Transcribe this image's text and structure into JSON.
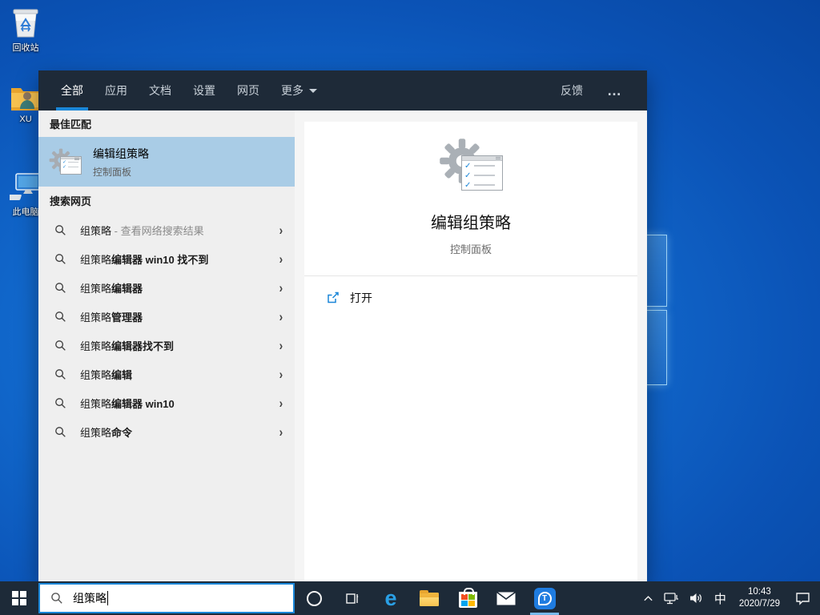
{
  "desktop": {
    "icons": [
      {
        "label": "回收站"
      },
      {
        "label": "XU"
      },
      {
        "label": "此电脑"
      }
    ]
  },
  "panel": {
    "tabs": [
      {
        "label": "全部",
        "active": true
      },
      {
        "label": "应用",
        "active": false
      },
      {
        "label": "文档",
        "active": false
      },
      {
        "label": "设置",
        "active": false
      },
      {
        "label": "网页",
        "active": false
      },
      {
        "label": "更多",
        "active": false
      }
    ],
    "feedback_label": "反馈",
    "overflow_label": "…",
    "best_match_header": "最佳匹配",
    "best_match": {
      "title": "编辑组策略",
      "subtitle": "控制面板"
    },
    "web_header": "搜索网页",
    "suggestions": [
      {
        "prefix": "组策略",
        "suffix": " - 查看网络搜索结果",
        "type": "web"
      },
      {
        "prefix": "组策略",
        "suffix": "编辑器 win10 找不到",
        "type": "query"
      },
      {
        "prefix": "组策略",
        "suffix": "编辑器",
        "type": "query"
      },
      {
        "prefix": "组策略",
        "suffix": "管理器",
        "type": "query"
      },
      {
        "prefix": "组策略",
        "suffix": "编辑器找不到",
        "type": "query"
      },
      {
        "prefix": "组策略",
        "suffix": "编辑",
        "type": "query"
      },
      {
        "prefix": "组策略",
        "suffix": "编辑器 win10",
        "type": "query"
      },
      {
        "prefix": "组策略",
        "suffix": "命令",
        "type": "query"
      }
    ],
    "chevron_glyph": "›",
    "preview": {
      "title": "编辑组策略",
      "subtitle": "控制面板",
      "open_label": "打开"
    }
  },
  "taskbar": {
    "search_value": "组策略",
    "tray": {
      "ime": "中",
      "time": "10:43",
      "date": "2020/7/29"
    }
  },
  "icons": [
    "recycle-bin-icon",
    "user-folder-icon",
    "this-pc-icon",
    "search-icon",
    "chevron-right-icon",
    "gear-checklist-icon",
    "open-external-icon",
    "chevron-down-icon",
    "ellipsis-icon",
    "windows-start-icon",
    "cortana-icon",
    "task-view-icon",
    "edge-icon",
    "file-explorer-icon",
    "store-icon",
    "mail-icon",
    "driver-app-icon",
    "chevron-up-icon",
    "network-icon",
    "volume-icon",
    "action-center-icon"
  ],
  "colors": {
    "accent": "#1a86d8",
    "best_match_highlight": "#a9cce6",
    "header_bg": "#1e2a38",
    "taskbar_bg": "#1d2a38",
    "list_bg": "#efefef",
    "preview_bg": "#f5f5f5"
  }
}
